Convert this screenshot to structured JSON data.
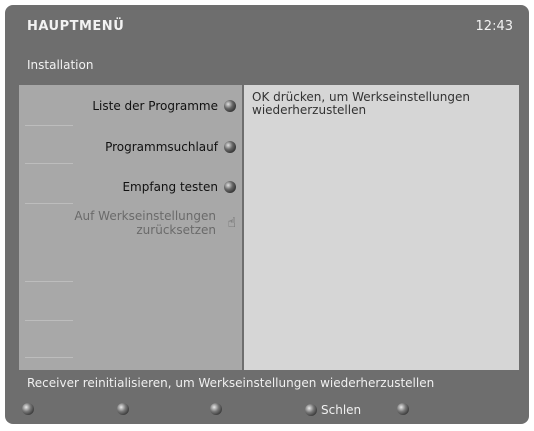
{
  "header": {
    "title": "HAUPTMENÜ",
    "time": "12:43"
  },
  "breadcrumb": "Installation",
  "menu": {
    "items": [
      {
        "label": "Liste der Programme",
        "icon": "ok-button-icon"
      },
      {
        "label": "Programmsuchlauf",
        "icon": "ok-button-icon"
      },
      {
        "label": "Empfang testen",
        "icon": "ok-button-icon"
      },
      {
        "label_line1": "Auf Werkseinstellungen",
        "label_line2": "zurücksetzen",
        "icon": "hand-pointer-icon"
      }
    ]
  },
  "info": {
    "text": "OK drücken, um Werkseinstellungen wiederherzustellen"
  },
  "status_text": "Receiver reinitialisieren, um Werkseinstellungen wiederherzustellen",
  "footer": {
    "buttons": [
      {
        "label": ""
      },
      {
        "label": ""
      },
      {
        "label": ""
      },
      {
        "label": "Schlen"
      },
      {
        "label": ""
      }
    ]
  },
  "colors": {
    "frame": "#6e6e6e",
    "menu_panel": "#a8a8a8",
    "info_panel": "#d6d6d6"
  }
}
